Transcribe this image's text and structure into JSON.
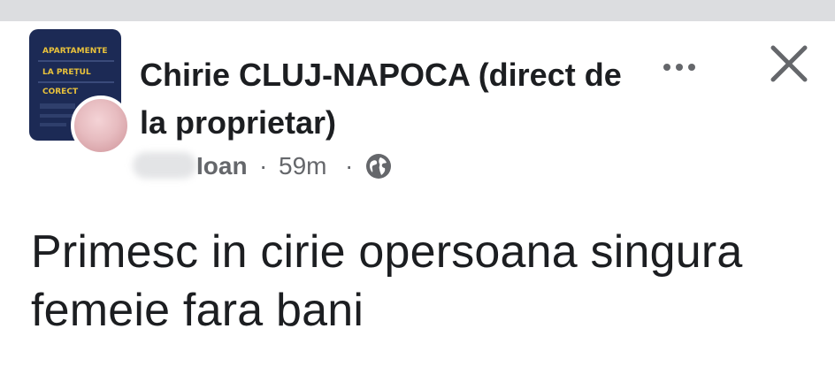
{
  "group": {
    "avatar_lines": [
      "APARTAMENTE",
      "LA PREȚUL",
      "CORECT"
    ],
    "name": "Chirie CLUJ-NAPOCA (direct de la proprietar)"
  },
  "post": {
    "author": "Ioan",
    "separator": "·",
    "time": "59m",
    "privacy_icon": "globe-icon",
    "text": "Primesc in cirie opersoana singura femeie fara bani"
  },
  "actions": {
    "more_icon": "more-horizontal-icon",
    "close_icon": "close-icon"
  },
  "colors": {
    "top_bar": "#dcdde0",
    "primary_text": "#1c1e21",
    "secondary_text": "#65676b",
    "avatar_bg": "#1c2a55",
    "avatar_text": "#e9c23b"
  }
}
